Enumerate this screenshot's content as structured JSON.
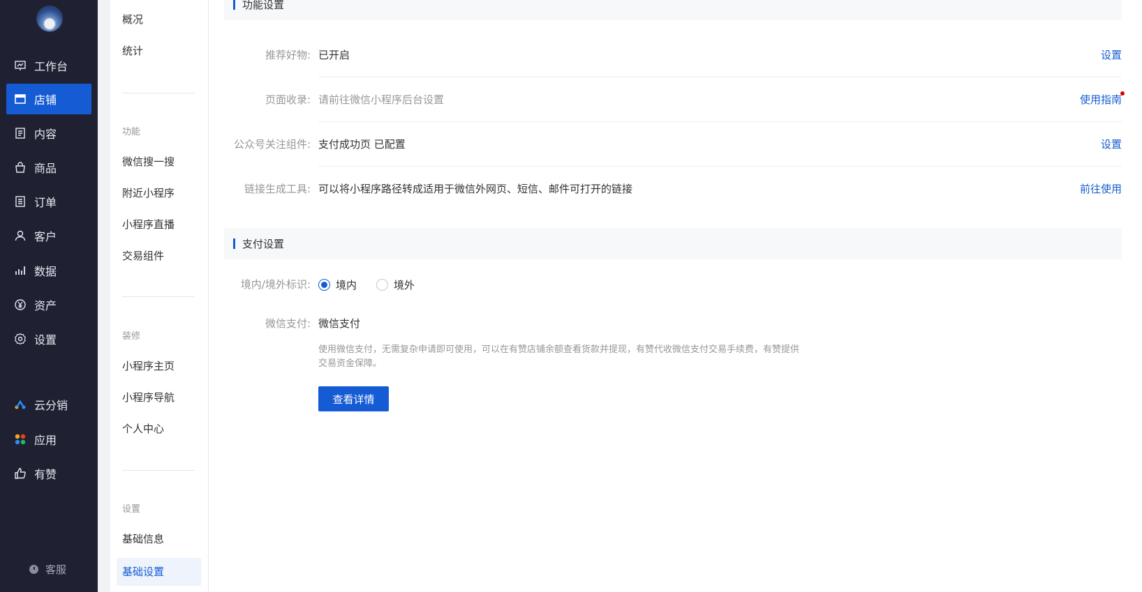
{
  "primary_nav": {
    "items": [
      {
        "label": "工作台",
        "icon": "workbench-icon"
      },
      {
        "label": "店铺",
        "icon": "store-icon",
        "active": true
      },
      {
        "label": "内容",
        "icon": "content-icon"
      },
      {
        "label": "商品",
        "icon": "bag-icon"
      },
      {
        "label": "订单",
        "icon": "order-icon"
      },
      {
        "label": "客户",
        "icon": "user-icon"
      },
      {
        "label": "数据",
        "icon": "chart-icon"
      },
      {
        "label": "资产",
        "icon": "yuan-icon"
      },
      {
        "label": "设置",
        "icon": "gear-icon"
      },
      {
        "label": "云分销",
        "icon": "cloud-distribution-icon"
      },
      {
        "label": "应用",
        "icon": "apps-icon"
      },
      {
        "label": "有赞",
        "icon": "thumb-up-icon"
      }
    ],
    "service_label": "客服"
  },
  "secondary_nav": {
    "top": [
      "概况",
      "统计"
    ],
    "groups": [
      {
        "title": "功能",
        "items": [
          "微信搜一搜",
          "附近小程序",
          "小程序直播",
          "交易组件"
        ]
      },
      {
        "title": "装修",
        "items": [
          "小程序主页",
          "小程序导航",
          "个人中心"
        ]
      },
      {
        "title": "设置",
        "items": [
          "基础信息",
          "基础设置"
        ]
      }
    ]
  },
  "feature_section": {
    "title": "功能设置",
    "rows": [
      {
        "label": "推荐好物:",
        "value": "已开启",
        "action": "设置"
      },
      {
        "label": "页面收录:",
        "value": "请前往微信小程序后台设置",
        "action": "使用指南"
      },
      {
        "label": "公众号关注组件:",
        "value": "支付成功页 已配置",
        "action": "设置"
      },
      {
        "label": "链接生成工具:",
        "value": "可以将小程序路径转成适用于微信外网页、短信、邮件可打开的链接",
        "action": "前往使用"
      }
    ]
  },
  "payment_section": {
    "title": "支付设置",
    "region_label": "境内/境外标识:",
    "region_options": [
      "境内",
      "境外"
    ],
    "wechat_label": "微信支付:",
    "wechat_value": "微信支付",
    "wechat_desc": "使用微信支付，无需复杂申请即可使用，可以在有赞店铺余额查看货款并提现，有赞代收微信支付交易手续费，有赞提供交易资金保障。",
    "detail_button": "查看详情"
  },
  "colors": {
    "accent": "#155bd4",
    "sidebar": "#1f2133"
  }
}
